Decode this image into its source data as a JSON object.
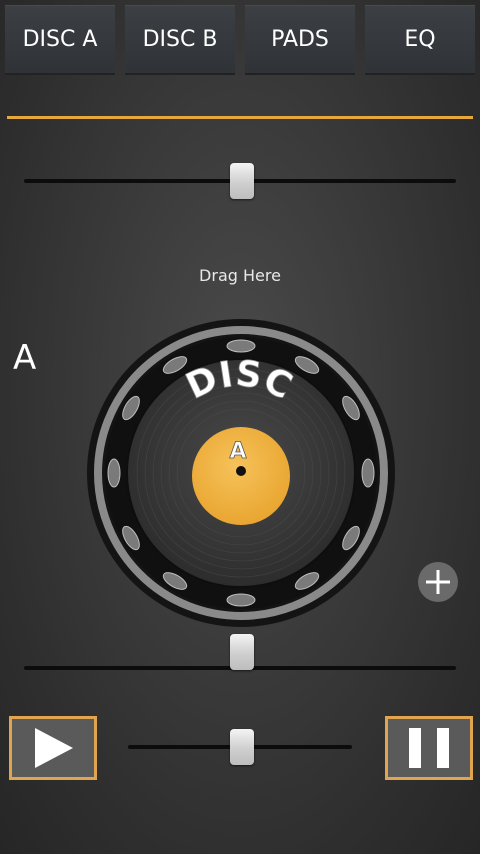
{
  "tabs": [
    {
      "label": "DISC A"
    },
    {
      "label": "DISC B"
    },
    {
      "label": "PADS"
    },
    {
      "label": "EQ"
    }
  ],
  "hint": {
    "drag_label": "Drag Here"
  },
  "deck": {
    "letter": "A"
  },
  "disc": {
    "word": "DISC",
    "letter": "A"
  },
  "sliders": {
    "crossfader_top": 0.5,
    "pitch": 0.5,
    "volume": 0.5
  },
  "colors": {
    "accent": "#e6a83c",
    "label_yellow": "#f2b33d",
    "button_border": "#e2a54f"
  },
  "icons": {
    "add": "plus-icon",
    "play": "play-icon",
    "pause": "pause-icon"
  }
}
